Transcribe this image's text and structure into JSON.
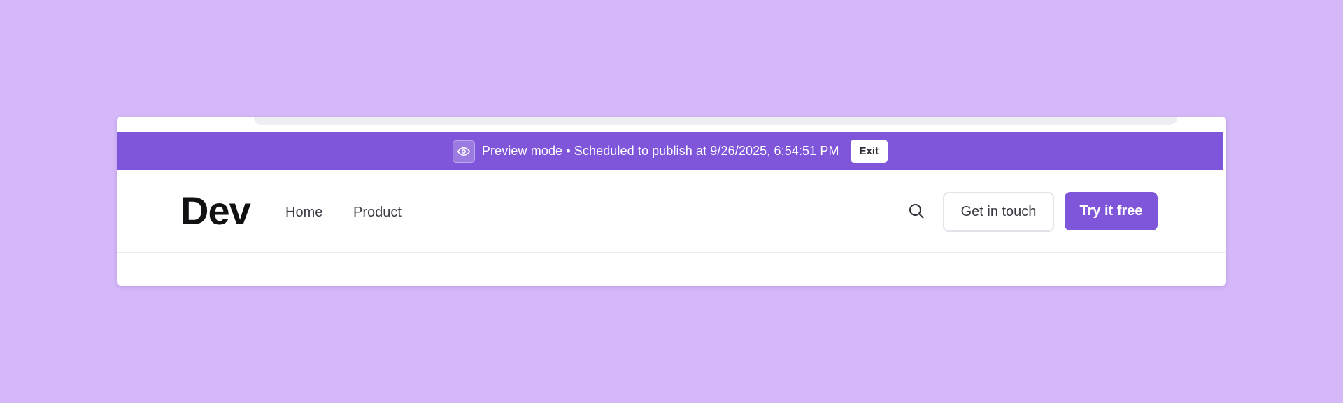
{
  "banner": {
    "icon": "eye-icon",
    "text": "Preview mode • Scheduled to publish at 9/26/2025, 6:54:51 PM",
    "exit_label": "Exit",
    "color": "#7f55d9"
  },
  "header": {
    "logo": "Dev",
    "nav": [
      {
        "label": "Home"
      },
      {
        "label": "Product"
      }
    ],
    "search_icon": "search-icon",
    "get_in_touch_label": "Get in touch",
    "try_free_label": "Try it free",
    "accent": "#7f55d9"
  }
}
